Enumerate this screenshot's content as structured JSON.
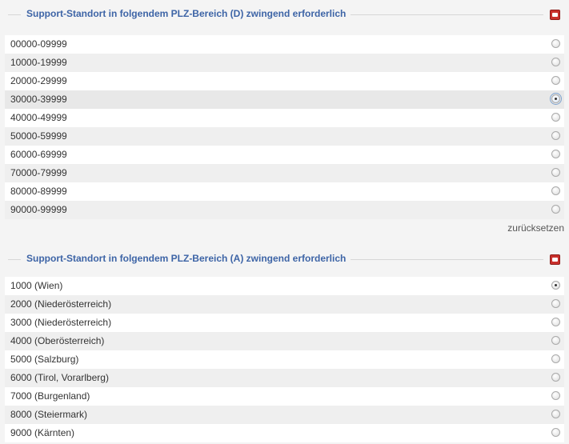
{
  "section_d": {
    "title": "Support-Standort in folgendem PLZ-Bereich (D) zwingend erforderlich",
    "options": [
      {
        "label": "00000-09999"
      },
      {
        "label": "10000-19999"
      },
      {
        "label": "20000-29999"
      },
      {
        "label": "30000-39999",
        "checked": true
      },
      {
        "label": "40000-49999"
      },
      {
        "label": "50000-59999"
      },
      {
        "label": "60000-69999"
      },
      {
        "label": "70000-79999"
      },
      {
        "label": "80000-89999"
      },
      {
        "label": "90000-99999"
      }
    ],
    "reset_label": "zurücksetzen"
  },
  "section_a": {
    "title": "Support-Standort in folgendem PLZ-Bereich (A) zwingend erforderlich",
    "options": [
      {
        "label": "1000 (Wien)",
        "checked": true
      },
      {
        "label": "2000 (Niederösterreich)"
      },
      {
        "label": "3000 (Niederösterreich)"
      },
      {
        "label": "4000 (Oberösterreich)"
      },
      {
        "label": "5000 (Salzburg)"
      },
      {
        "label": "6000 (Tirol, Vorarlberg)"
      },
      {
        "label": "7000 (Burgenland)"
      },
      {
        "label": "8000 (Steiermark)"
      },
      {
        "label": "9000 (Kärnten)"
      }
    ]
  },
  "colors": {
    "title": "#3d64a6",
    "close_button": "#c9302c"
  },
  "icons": {
    "close": "close-icon",
    "radio": "radio-icon"
  }
}
